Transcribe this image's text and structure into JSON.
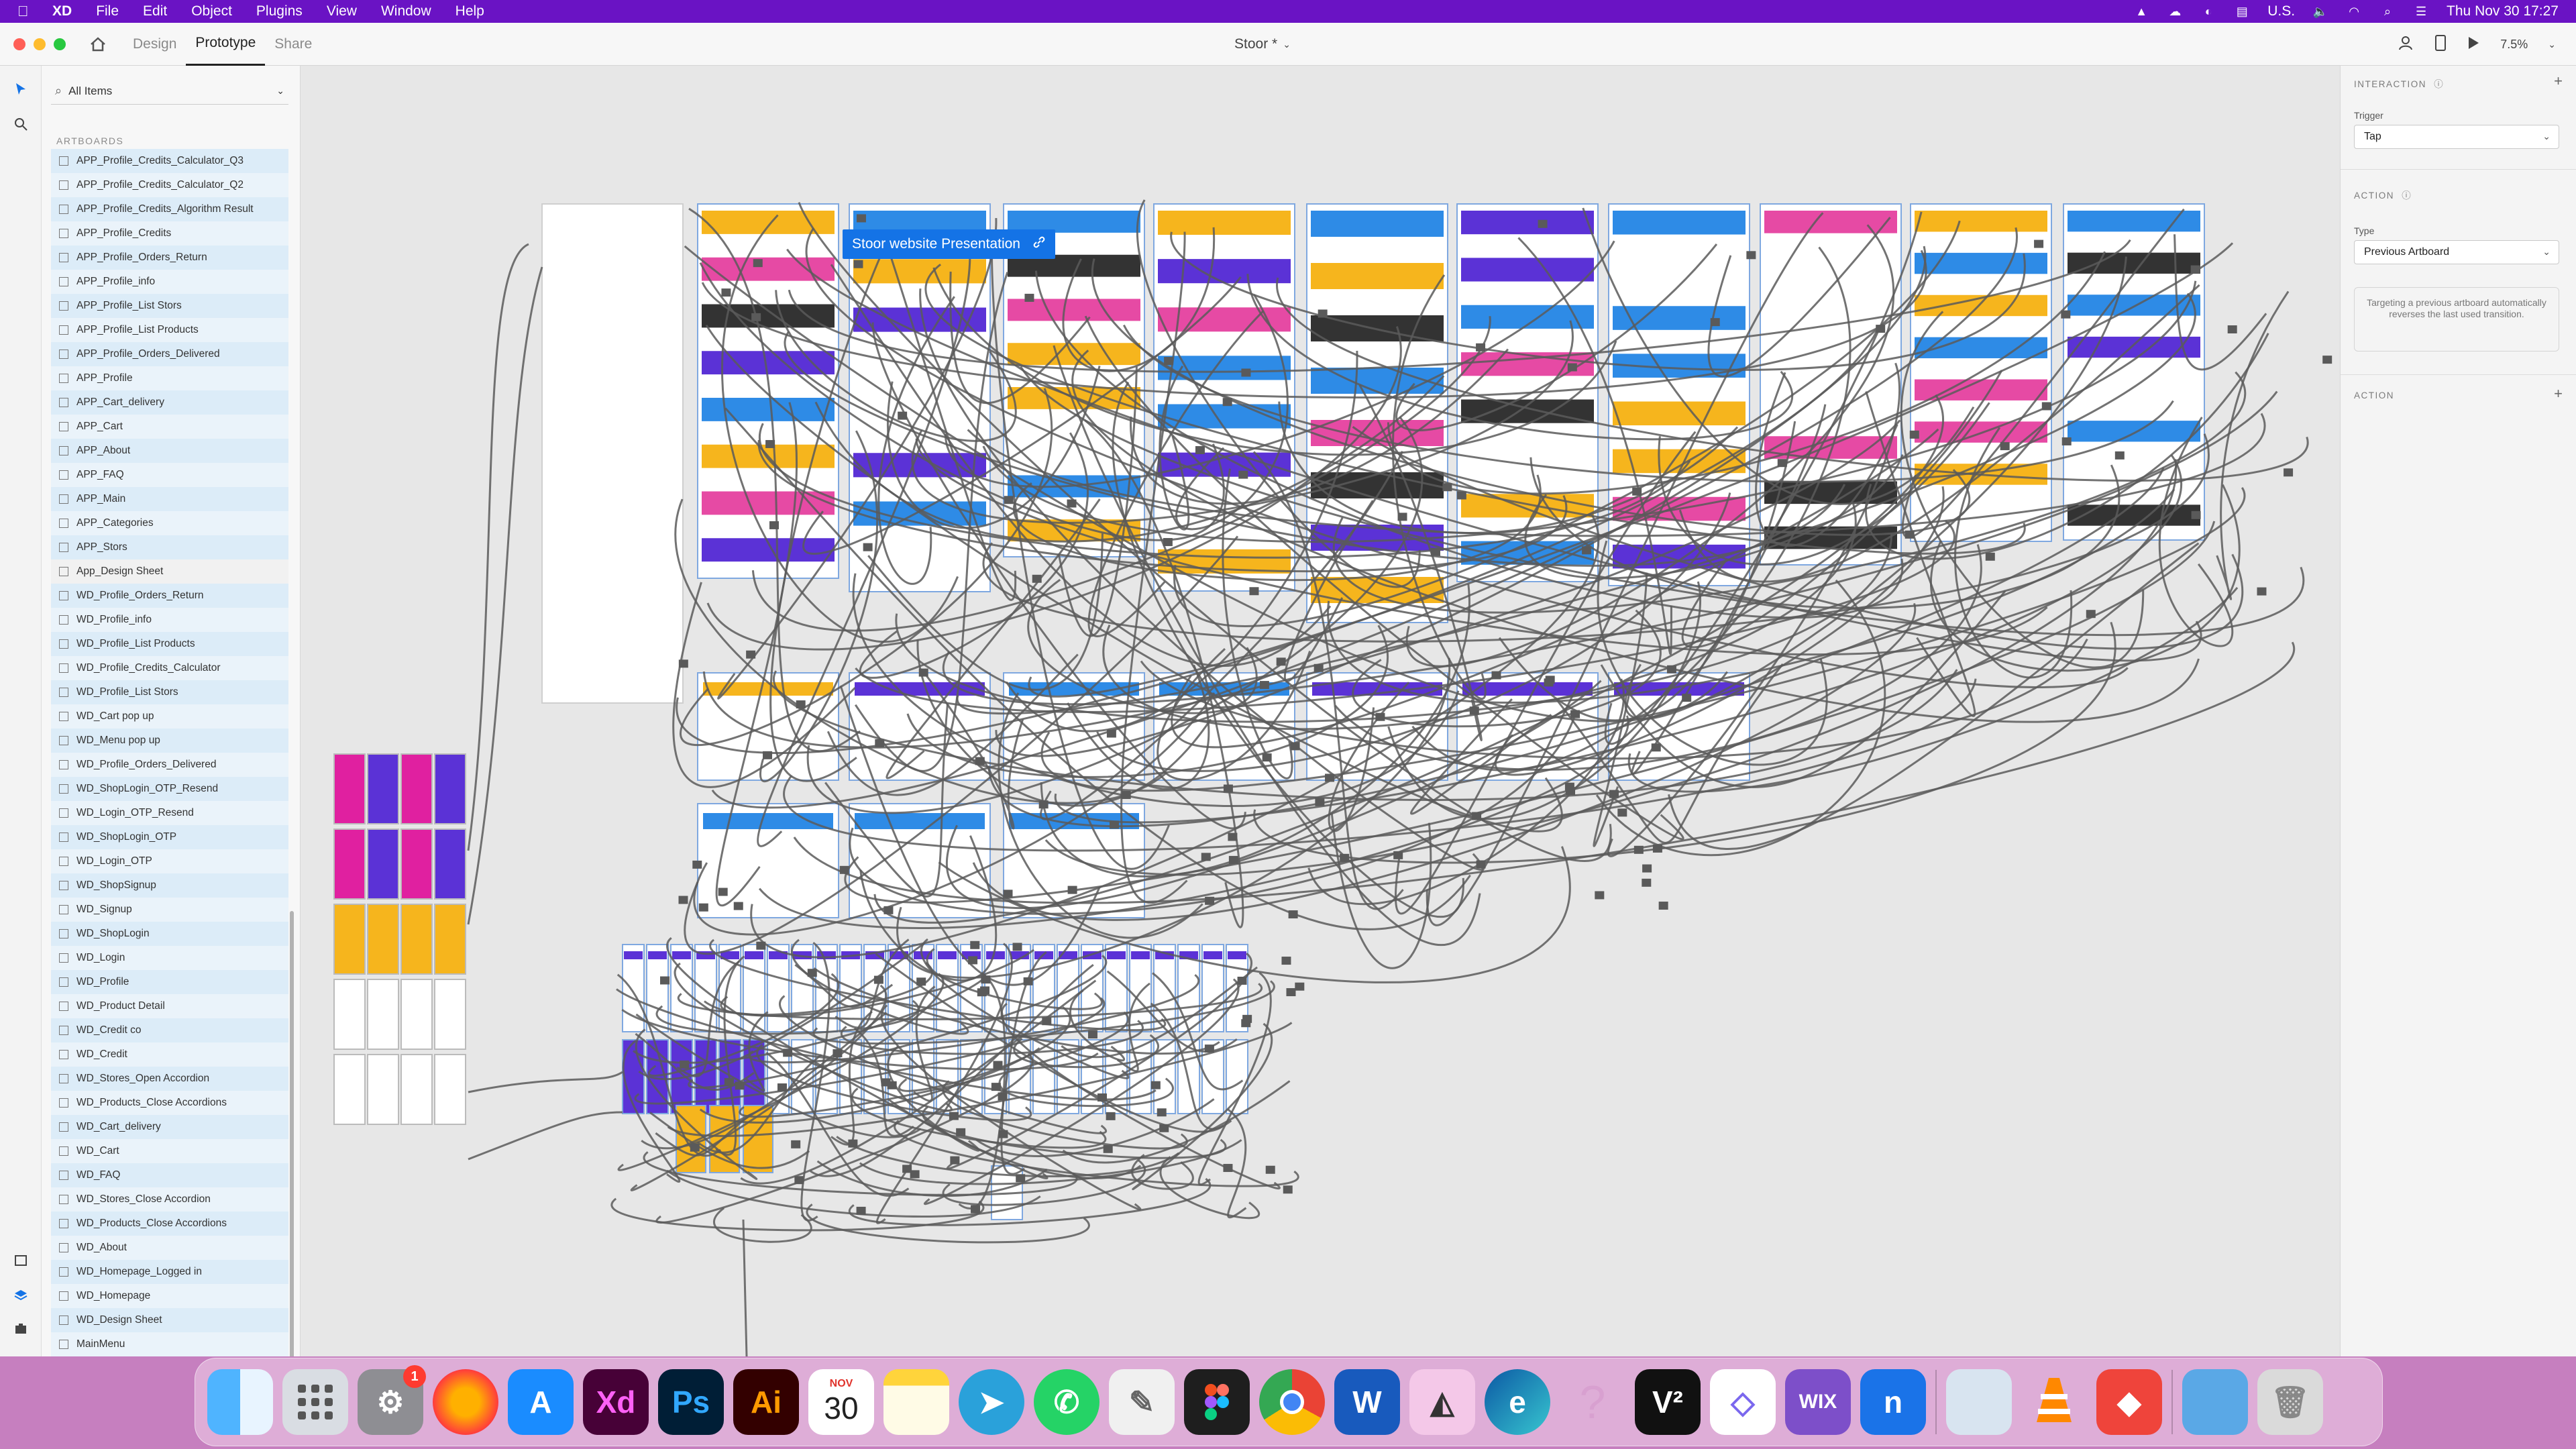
{
  "menubar": {
    "app": "XD",
    "items": [
      "File",
      "Edit",
      "Object",
      "Plugins",
      "View",
      "Window",
      "Help"
    ],
    "input_source": "U.S.",
    "clock": "Thu Nov 30  17:27"
  },
  "toolbar": {
    "tabs": [
      "Design",
      "Prototype",
      "Share"
    ],
    "active_tab": "Prototype",
    "doc_title": "Stoor *",
    "zoom": "7.5%"
  },
  "layers": {
    "search_placeholder": "All Items",
    "section_label": "ARTBOARDS",
    "items": [
      "APP_Profile_Credits_Calculator_Q3",
      "APP_Profile_Credits_Calculator_Q2",
      "APP_Profile_Credits_Algorithm Result",
      "APP_Profile_Credits",
      "APP_Profile_Orders_Return",
      "APP_Profile_info",
      "APP_Profile_List Stors",
      "APP_Profile_List Products",
      "APP_Profile_Orders_Delivered",
      "APP_Profile",
      "APP_Cart_delivery",
      "APP_Cart",
      "APP_About",
      "APP_FAQ",
      "APP_Main",
      "APP_Categories",
      "APP_Stors",
      "App_Design Sheet",
      "WD_Profile_Orders_Return",
      "WD_Profile_info",
      "WD_Profile_List Products",
      "WD_Profile_Credits_Calculator",
      "WD_Profile_List Stors",
      "WD_Cart pop up",
      "WD_Menu pop up",
      "WD_Profile_Orders_Delivered",
      "WD_ShopLogin_OTP_Resend",
      "WD_Login_OTP_Resend",
      "WD_ShopLogin_OTP",
      "WD_Login_OTP",
      "WD_ShopSignup",
      "WD_Signup",
      "WD_ShopLogin",
      "WD_Login",
      "WD_Profile",
      "WD_Product Detail",
      "WD_Credit co",
      "WD_Credit",
      "WD_Stores_Open Accordion",
      "WD_Products_Close Accordions",
      "WD_Cart_delivery",
      "WD_Cart",
      "WD_FAQ",
      "WD_Stores_Close Accordion",
      "WD_Products_Close Accordions",
      "WD_About",
      "WD_Homepage_Logged in",
      "WD_Homepage",
      "WD_Design Sheet",
      "MainMenu"
    ]
  },
  "canvas": {
    "flow_label": "Stoor website Presentation"
  },
  "interaction": {
    "header": "INTERACTION",
    "trigger_label": "Trigger",
    "trigger_value": "Tap",
    "action_header": "ACTION",
    "type_label": "Type",
    "type_value": "Previous Artboard",
    "note": "Targeting a previous artboard automatically reverses the last used transition.",
    "action_header_2": "ACTION"
  },
  "dock": {
    "calendar_month": "NOV",
    "calendar_day": "30",
    "settings_badge": "1",
    "apps": [
      "finder-icon",
      "launchpad-icon",
      "system-settings-icon",
      "firefox-icon",
      "app-store-icon",
      "xd-icon",
      "photoshop-icon",
      "illustrator-icon",
      "calendar-icon",
      "notes-icon",
      "telegram-icon",
      "whatsapp-icon",
      "script-editor-icon",
      "figma-icon",
      "chrome-icon",
      "word-icon",
      "pencil-app-icon",
      "edge-icon",
      "help-icon",
      "v2-icon",
      "clickup-icon",
      "wix-icon",
      "notion-icon",
      "preview-icon",
      "vlc-icon",
      "anydesk-icon",
      "folder-icon",
      "trash-icon"
    ],
    "labels": {
      "xd": "Xd",
      "ps": "Ps",
      "ai": "Ai",
      "wix": "WIX"
    }
  },
  "colors": {
    "menubar": "#6a13c4",
    "accent_blue": "#1473e6",
    "wire": "#5a5a5a"
  }
}
